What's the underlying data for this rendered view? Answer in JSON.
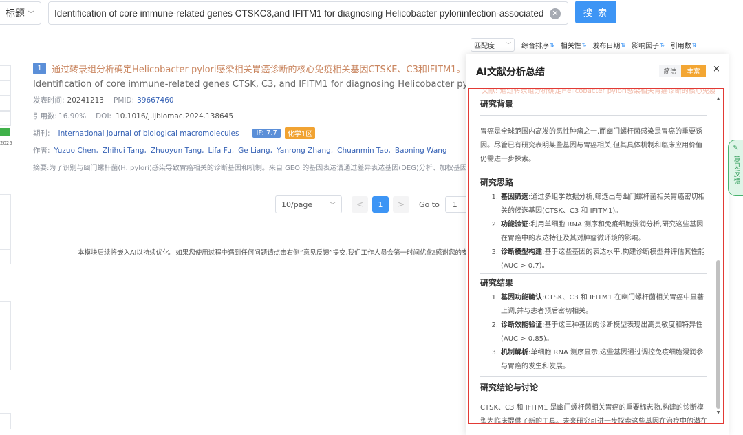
{
  "search": {
    "type_label": "标题",
    "query": "Identification of core immune-related genes CTSKC3,and IFITM1 for diagnosing Helicobacter pyloriinfection-associated gas",
    "button_label": "搜 索"
  },
  "sort": {
    "select_value": "匹配度",
    "items": [
      "综合排序",
      "相关性",
      "发布日期",
      "影响因子",
      "引用数"
    ]
  },
  "left": {
    "year_fragment": "2025"
  },
  "result": {
    "index": "1",
    "title_cn": "通过转录组分析确定Helicobacter pylori感染相关胃癌诊断的核心免疫相关基因CTSKE、C3和IFITM1。",
    "title_en": "Identification of core immune-related genes CTSK, C3, and IFITM1 for diagnosing Helicobacter pylori infection-associated gastric cancer",
    "pub_label": "发表时间:",
    "pub_value": "20241213",
    "pmid_label": "PMID:",
    "pmid_value": "39667460",
    "cite_label": "引用数:",
    "cite_value": "16.90%",
    "doi_label": "DOI:",
    "doi_value": "10.1016/j.ijbiomac.2024.138645",
    "journal_label": "期刊:",
    "journal_value": "International journal of biological macromolecules",
    "if_tag": "IF: 7.7",
    "zone_tag": "化学1区",
    "author_label": "作者:",
    "authors": [
      "Yuzuo Chen,",
      "Zhihui Tang,",
      "Zhuoyun Tang,",
      "Lifa Fu,",
      "Ge Liang,",
      "Yanrong Zhang,",
      "Chuanmin Tao,",
      "Baoning Wang"
    ],
    "abstract": "摘要:为了识别与幽门螺杆菌(H. pylori)感染导致胃癌相关的诊断基因和机制。来自 GEO 的基因表达谱通过差异表达基因(DEG)分析、加权基因共表达网络分析"
  },
  "pager": {
    "page_size": "10/page",
    "current": "1",
    "prev": "<",
    "next": ">",
    "goto_label": "Go to",
    "goto_value": "1"
  },
  "footer_note": "本模块后续将嵌入AI以持续优化。如果您使用过程中遇到任何问题请点击右侧“意见反馈”提交,我们工作人员会第一时间优化!感谢您的支持",
  "ai_panel": {
    "title": "AI文献分析总结",
    "mode_simple": "简洁",
    "mode_rich": "丰富",
    "close": "×",
    "faded_line": "文献: 通过转录组分析确定Helicobacter pylori感染相关胃癌诊断的核心免疫",
    "sections": {
      "background": {
        "heading": "研究背景",
        "text": "胃癌是全球范围内高发的恶性肿瘤之一,而幽门螺杆菌感染是胃癌的重要诱因。尽管已有研究表明某些基因与胃癌相关,但其具体机制和临床应用价值仍需进一步探索。"
      },
      "approach": {
        "heading": "研究思路",
        "items": [
          {
            "num": "1.",
            "bold": "基因筛选",
            "text": ":通过多组学数据分析,筛选出与幽门螺杆菌相关胃癌密切相关的候选基因(CTSK、C3 和 IFITM1)。"
          },
          {
            "num": "2.",
            "bold": "功能验证",
            "text": ":利用单细胞 RNA 测序和免疫细胞浸润分析,研究这些基因在胃癌中的表达特征及其对肿瘤微环境的影响。"
          },
          {
            "num": "3.",
            "bold": "诊断模型构建",
            "text": ":基于这些基因的表达水平,构建诊断模型并评估其性能(AUC > 0.7)。"
          }
        ]
      },
      "results": {
        "heading": "研究结果",
        "items": [
          {
            "num": "1.",
            "bold": "基因功能确认",
            "text": ":CTSK、C3 和 IFITM1 在幽门螺杆菌相关胃癌中显著上调,并与患者预后密切相关。"
          },
          {
            "num": "2.",
            "bold": "诊断效能验证",
            "text": ":基于这三种基因的诊断模型表现出高灵敏度和特异性(AUC > 0.85)。"
          },
          {
            "num": "3.",
            "bold": "机制解析",
            "text": ":单细胞 RNA 测序显示,这些基因通过调控免疫细胞浸润参与胃癌的发生和发展。"
          }
        ]
      },
      "conclusion": {
        "heading": "研究结论与讨论",
        "text": "CTSK、C3 和 IFITM1 是幽门螺杆菌相关胃癌的重要标志物,构建的诊断模型为临床提供了新的工具。未来研究可进一步探索这些基因在治疗中的潜在作用,以改善患者的预后和生存质量。"
      }
    }
  },
  "feedback": {
    "label": "意见反馈"
  },
  "colors": {
    "accent": "#3d95f5",
    "frame": "#e23a35",
    "rich_mode": "#f3a633",
    "feedback": "#2e9b57"
  }
}
